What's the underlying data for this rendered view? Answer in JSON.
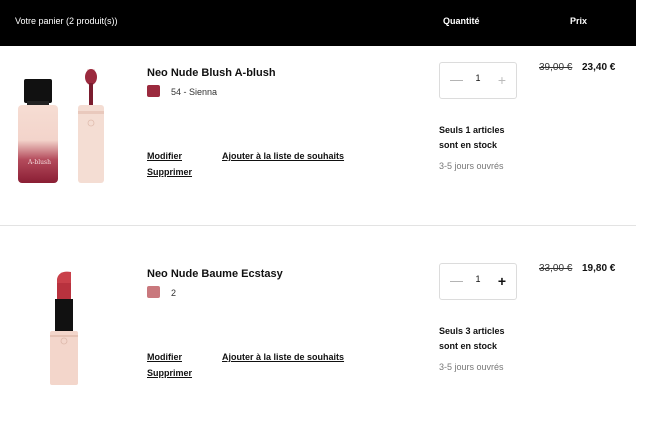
{
  "header": {
    "cart_label": "Votre panier (2 produit(s))",
    "quantity_label": "Quantité",
    "price_label": "Prix"
  },
  "items": [
    {
      "name": "Neo Nude Blush A-blush",
      "shade": "54 - Sienna",
      "swatch_color": "#9b2a3e",
      "modify": "Modifier",
      "wishlist": "Ajouter à la liste de souhaits",
      "remove": "Supprimer",
      "quantity": "1",
      "minus": "—",
      "plus": "+",
      "stock_line1": "Seuls 1 articles",
      "stock_line2": "sont en stock",
      "delivery": "3-5 jours ouvrés",
      "old_price": "39,00 €",
      "new_price": "23,40 €",
      "bottle_text": "A-blush"
    },
    {
      "name": "Neo Nude Baume Ecstasy",
      "shade": "2",
      "swatch_color": "#c9787d",
      "modify": "Modifier",
      "wishlist": "Ajouter à la liste de souhaits",
      "remove": "Supprimer",
      "quantity": "1",
      "minus": "—",
      "plus": "+",
      "stock_line1": "Seuls 3 articles",
      "stock_line2": "sont en stock",
      "delivery": "3-5 jours ouvrés",
      "old_price": "33,00 €",
      "new_price": "19,80 €"
    }
  ]
}
